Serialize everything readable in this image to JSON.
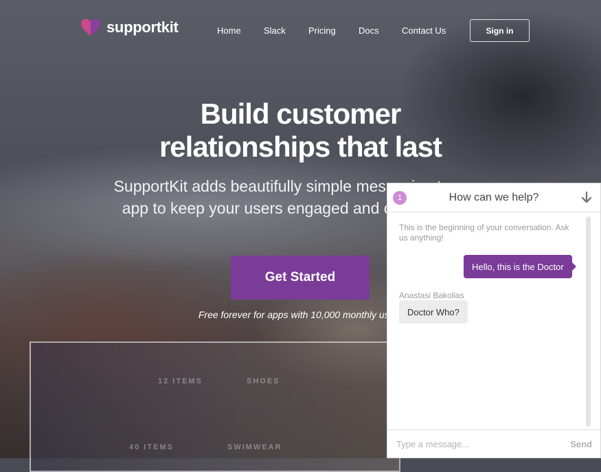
{
  "brand": {
    "name": "supportkit",
    "logo_icon": "heart-icon",
    "accent": "#7b3b98"
  },
  "nav": {
    "items": [
      {
        "label": "Home"
      },
      {
        "label": "Slack"
      },
      {
        "label": "Pricing"
      },
      {
        "label": "Docs"
      },
      {
        "label": "Contact Us"
      }
    ],
    "signin_label": "Sign in"
  },
  "hero": {
    "title_line1": "Build customer",
    "title_line2": "relationships that last",
    "subtitle": "SupportKit adds beautifully simple messaging to your app to keep your users engaged and coming back.",
    "cta_label": "Get Started",
    "note": "Free forever for apps with 10,000 monthly users"
  },
  "mockup": {
    "labels": [
      "12 ITEMS",
      "SHOES",
      "40 ITEMS",
      "SWIMWEAR"
    ]
  },
  "chat": {
    "badge_count": "1",
    "title": "How can we help?",
    "collapse_icon": "arrow-down-icon",
    "intro": "This is the beginning of your conversation. Ask us anything!",
    "messages": [
      {
        "from": "me",
        "text": "Hello, this is the Doctor"
      },
      {
        "from": "them",
        "sender": "Anastasi Bakolias",
        "text": "Doctor Who?"
      }
    ],
    "input_placeholder": "Type a message...",
    "send_label": "Send"
  }
}
